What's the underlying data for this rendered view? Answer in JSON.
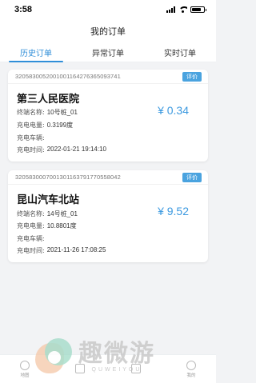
{
  "status_bar": {
    "time": "3:58"
  },
  "nav": {
    "title": "我的订单"
  },
  "tabs": [
    {
      "label": "历史订单",
      "active": true
    },
    {
      "label": "异常订单",
      "active": false
    },
    {
      "label": "实时订单",
      "active": false
    }
  ],
  "orders": [
    {
      "order_no": "32058300520010011642763650937​41",
      "rate_label": "评价",
      "station": "第三人民医院",
      "price": "¥ 0.34",
      "rows": [
        {
          "key": "终端名称:",
          "value": "10号桩_01"
        },
        {
          "key": "充电电量:",
          "value": "0.3199度"
        },
        {
          "key": "充电车辆:",
          "value": ""
        },
        {
          "key": "充电时间:",
          "value": "2022-01-21 19:14:10"
        }
      ]
    },
    {
      "order_no": "320583000700130116379177055804​2",
      "rate_label": "评价",
      "station": "昆山汽车北站",
      "price": "¥ 9.52",
      "rows": [
        {
          "key": "终端名称:",
          "value": "14号桩_01"
        },
        {
          "key": "充电电量:",
          "value": "10.8801度"
        },
        {
          "key": "充电车辆:",
          "value": ""
        },
        {
          "key": "充电时间:",
          "value": "2021-11-26 17:08:25"
        }
      ]
    }
  ],
  "tabbar": [
    {
      "label": "地图",
      "icon": "map-icon"
    },
    {
      "label": "",
      "icon": "scan-icon"
    },
    {
      "label": "",
      "icon": "order-icon"
    },
    {
      "label": "我的",
      "icon": "user-icon"
    }
  ],
  "watermark": {
    "cn": "趣微游",
    "en": "QUWEIYOU"
  },
  "colors": {
    "accent": "#2f8ed8",
    "price": "#3d9ae0",
    "rate_button": "#4aa3df",
    "background": "#f2f3f5"
  }
}
